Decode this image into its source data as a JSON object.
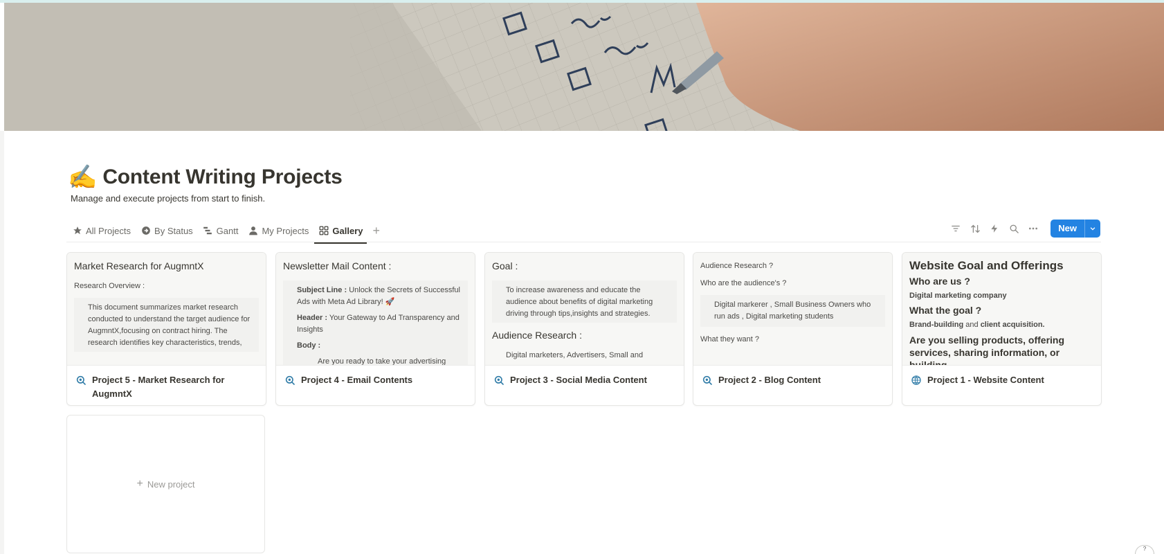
{
  "page": {
    "emoji": "✍️",
    "title": "Content Writing Projects",
    "description": "Manage and execute projects from start to finish."
  },
  "tabs": [
    {
      "label": "All Projects",
      "icon": "star-icon"
    },
    {
      "label": "By Status",
      "icon": "arrow-circle-icon"
    },
    {
      "label": "Gantt",
      "icon": "gantt-icon"
    },
    {
      "label": "My Projects",
      "icon": "person-icon"
    },
    {
      "label": "Gallery",
      "icon": "gallery-icon",
      "active": true
    }
  ],
  "toolbar": {
    "new_label": "New"
  },
  "cards": [
    {
      "title": "Project 5 - Market Research for AugmntX",
      "icon": "search-icon",
      "preview": {
        "heading": "Market Research for AugmntX",
        "subheading": "Research Overview :",
        "quote": "This document summarizes market research conducted to understand the target audience for AugmntX,focusing on contract hiring. The research identifies key characteristics, trends,"
      }
    },
    {
      "title": "Project 4 - Email Contents",
      "icon": "search-icon",
      "preview": {
        "heading": "Newsletter Mail Content :",
        "subject_label": "Subject Line :",
        "subject_text": "Unlock the Secrets of Successful Ads with Meta Ad Library! 🚀",
        "header_label": "Header :",
        "header_text": "Your Gateway to Ad Transparency and Insights",
        "body_label": "Body :",
        "body_text": "Are you ready to take your advertising"
      }
    },
    {
      "title": "Project 3 - Social Media Content",
      "icon": "search-icon",
      "preview": {
        "heading": "Goal :",
        "quote": "To increase awareness and educate the audience about benefits of digital marketing driving through tips,insights and strategies.",
        "heading2": "Audience Research :",
        "text": "Digital marketers, Advertisers, Small and"
      }
    },
    {
      "title": "Project  2 - Blog Content",
      "icon": "search-icon",
      "preview": {
        "line1": "Audience Research ?",
        "line2": "Who are the audience's ?",
        "quote": "Digital markerer , Small Business Owners who run ads , Digital marketing students",
        "line3": "What they want ?"
      }
    },
    {
      "title": "Project 1 - Website Content",
      "icon": "globe-icon",
      "preview": {
        "heading": "Website Goal and Offerings",
        "q1": "Who are us ?",
        "a1": "Digital marketing company",
        "q2": "What the goal ?",
        "a2_bold1": "Brand-building",
        "a2_mid": " and ",
        "a2_bold2": "client acquisition.",
        "q3": "Are you selling products, offering services, sharing information, or building"
      }
    }
  ],
  "new_card_label": "New project",
  "help_label": "?"
}
